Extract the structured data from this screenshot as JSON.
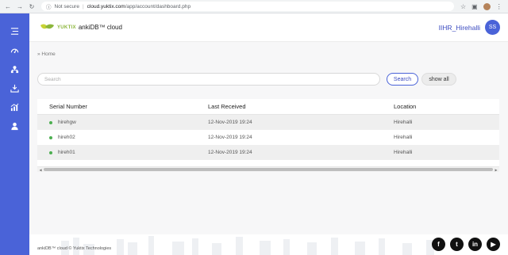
{
  "browser": {
    "security_label": "Not secure",
    "url_host": "cloud.yuktix.com",
    "url_path": "/app/account/dashboard.php"
  },
  "brand": {
    "logo_text": "YUKTIX",
    "app_name": "ankiDB™ cloud",
    "accent_color": "#8cb63c"
  },
  "sidebar": {
    "color": "#4a63d8",
    "items": [
      {
        "icon": "menu-icon"
      },
      {
        "icon": "dashboard-gauge-icon"
      },
      {
        "icon": "sitemap-icon"
      },
      {
        "icon": "download-icon"
      },
      {
        "icon": "chart-icon"
      },
      {
        "icon": "user-icon"
      }
    ]
  },
  "user": {
    "name": "IIHR_Hirehalli",
    "initials": "SS"
  },
  "breadcrumb": "» Home",
  "search": {
    "placeholder": "Search",
    "search_label": "Search",
    "show_all_label": "show all"
  },
  "table": {
    "headers": [
      "Serial Number",
      "Last Received",
      "Location"
    ],
    "rows": [
      {
        "serial": "hirehgw",
        "last_received": "12-Nov-2019 19:24",
        "location": "Hirehalli",
        "status": "online"
      },
      {
        "serial": "hireh02",
        "last_received": "12-Nov-2019 19:24",
        "location": "Hirehalli",
        "status": "online"
      },
      {
        "serial": "hireh01",
        "last_received": "12-Nov-2019 19:24",
        "location": "Hirehalli",
        "status": "online"
      }
    ]
  },
  "footer": {
    "copyright": "ankiDB™ cloud © Yuktix Technologies",
    "socials": [
      {
        "icon": "facebook-icon",
        "glyph": "f"
      },
      {
        "icon": "twitter-icon",
        "glyph": "t"
      },
      {
        "icon": "linkedin-icon",
        "glyph": "in"
      },
      {
        "icon": "youtube-icon",
        "glyph": "▶"
      }
    ]
  }
}
